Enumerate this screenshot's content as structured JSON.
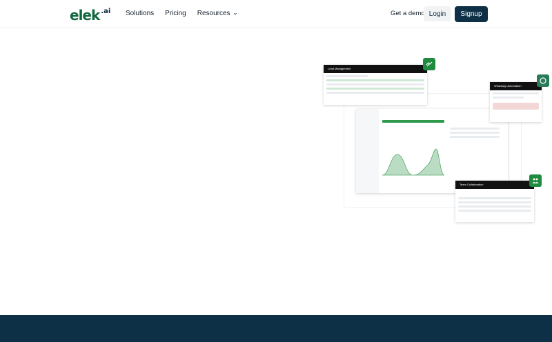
{
  "brand": {
    "logo_text": "elek",
    "logo_suffix": ".ai",
    "accent": "#11683f",
    "navy": "#0e3047"
  },
  "nav": {
    "items": [
      {
        "label": "Solutions"
      },
      {
        "label": "Pricing"
      },
      {
        "label": "Resources",
        "has_dropdown": true
      }
    ]
  },
  "actions": {
    "demo_label": "Get a demo",
    "login_label": "Login",
    "signup_label": "Signup"
  },
  "mockups": {
    "lead_title": "Lead Management",
    "whatsapp_title": "WhatsApp Automation",
    "team_title": "Team Collaboration",
    "icons": [
      "handshake-icon",
      "whatsapp-icon",
      "team-icon"
    ]
  }
}
